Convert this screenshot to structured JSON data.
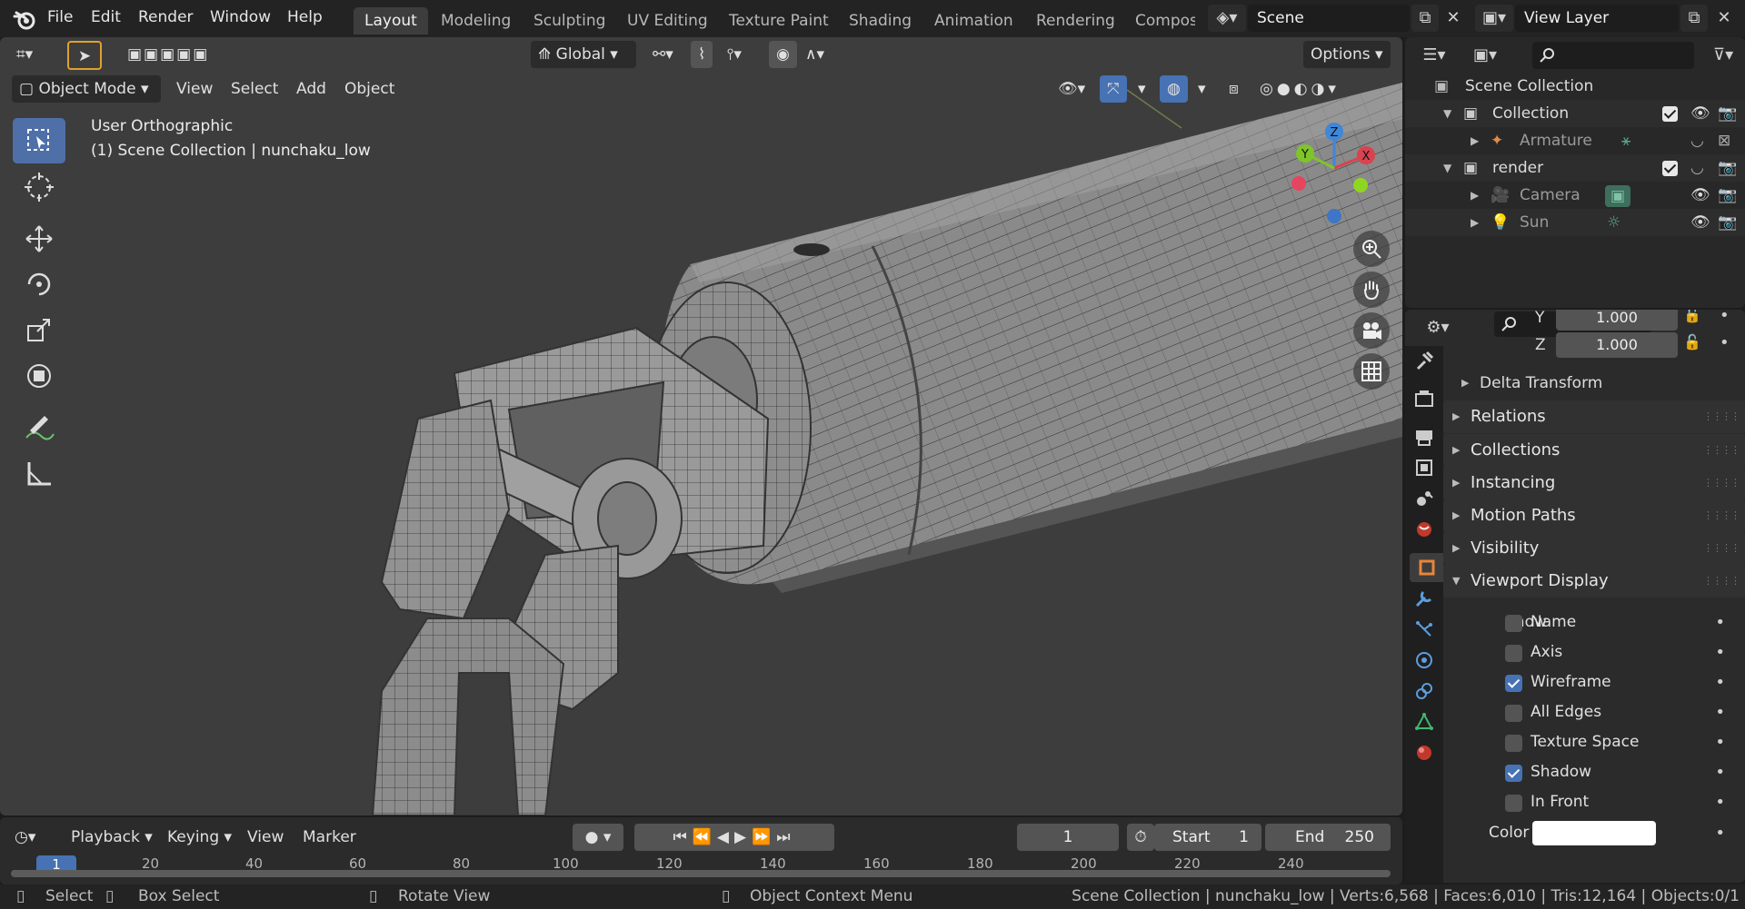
{
  "topbar": {
    "menus": [
      "File",
      "Edit",
      "Render",
      "Window",
      "Help"
    ],
    "workspaces": [
      "Layout",
      "Modeling",
      "Sculpting",
      "UV Editing",
      "Texture Paint",
      "Shading",
      "Animation",
      "Rendering",
      "Compos"
    ],
    "active_workspace": "Layout",
    "scene_name": "Scene",
    "view_layer": "View Layer"
  },
  "viewport": {
    "mode": "Object Mode",
    "menus": [
      "View",
      "Select",
      "Add",
      "Object"
    ],
    "transform_orientation": "Global",
    "options_label": "Options",
    "view_name": "User Orthographic",
    "collection_info": "(1) Scene Collection | nunchaku_low",
    "gizmo_axes": {
      "z": "Z",
      "y": "Y",
      "x": "X"
    },
    "colors": {
      "background": "#3d3d3d",
      "active_tool": "#4f6fa8",
      "axis_x": "#d9434f",
      "axis_y": "#7ec52a",
      "axis_z": "#3f87d8"
    },
    "tools": [
      "select-box-icon",
      "cursor-icon",
      "move-icon",
      "rotate-icon",
      "scale-icon",
      "transform-icon",
      "annotate-icon",
      "measure-icon"
    ]
  },
  "timeline": {
    "menus": [
      "Playback",
      "Keying",
      "View",
      "Marker"
    ],
    "current_frame": "1",
    "start_label": "Start",
    "start_value": "1",
    "end_label": "End",
    "end_value": "250",
    "ruler": [
      "1",
      "20",
      "40",
      "60",
      "80",
      "100",
      "120",
      "140",
      "160",
      "180",
      "200",
      "220",
      "240"
    ]
  },
  "statusbar": {
    "select": "Select",
    "box_select": "Box Select",
    "rotate_view": "Rotate View",
    "context_menu": "Object Context Menu",
    "stats": "Scene Collection | nunchaku_low | Verts:6,568 | Faces:6,010 | Tris:12,164 | Objects:0/1"
  },
  "outliner": {
    "root": "Scene Collection",
    "rows": [
      {
        "label": "Collection",
        "level": 1
      },
      {
        "label": "Armature",
        "level": 2
      },
      {
        "label": "render",
        "level": 1
      },
      {
        "label": "Camera",
        "level": 2
      },
      {
        "label": "Sun",
        "level": 2
      }
    ]
  },
  "properties": {
    "scale_y_label": "Y",
    "scale_y": "1.000",
    "scale_z_label": "Z",
    "scale_z": "1.000",
    "delta_transform": "Delta Transform",
    "sections": [
      "Relations",
      "Collections",
      "Instancing",
      "Motion Paths",
      "Visibility",
      "Viewport Display"
    ],
    "show_label": "Show",
    "show_options": [
      {
        "label": "Name",
        "checked": false
      },
      {
        "label": "Axis",
        "checked": false
      },
      {
        "label": "Wireframe",
        "checked": true
      },
      {
        "label": "All Edges",
        "checked": false
      },
      {
        "label": "Texture Space",
        "checked": false
      },
      {
        "label": "Shadow",
        "checked": true
      },
      {
        "label": "In Front",
        "checked": false
      }
    ],
    "color_label": "Color",
    "color_value": "#ffffff"
  }
}
